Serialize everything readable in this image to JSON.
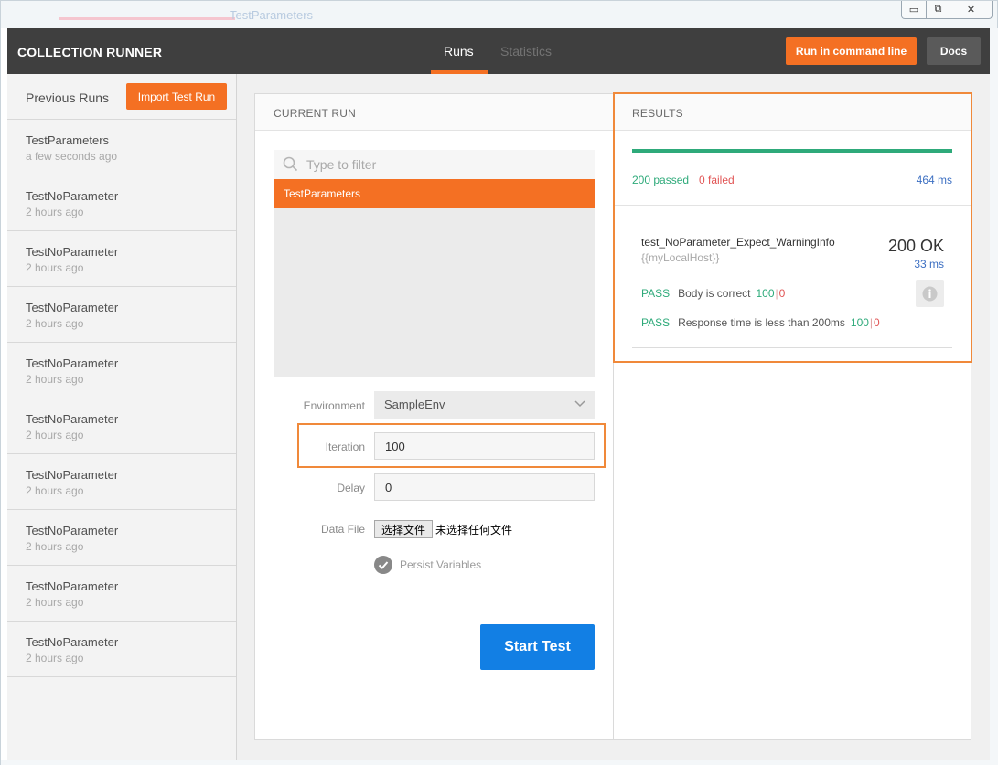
{
  "background": {
    "title": "TestParameters"
  },
  "window_controls": {
    "minimize": "▭",
    "maximize": "⧉",
    "close": "✕"
  },
  "header": {
    "title": "COLLECTION RUNNER",
    "tabs": [
      {
        "label": "Runs",
        "active": true
      },
      {
        "label": "Statistics",
        "active": false
      }
    ],
    "run_cmd_label": "Run in command line",
    "docs_label": "Docs",
    "accent_color": "#f47023"
  },
  "sidebar": {
    "heading": "Previous Runs",
    "import_label": "Import Test Run",
    "runs": [
      {
        "name": "TestParameters",
        "time": "a few seconds ago"
      },
      {
        "name": "TestNoParameter",
        "time": "2 hours ago"
      },
      {
        "name": "TestNoParameter",
        "time": "2 hours ago"
      },
      {
        "name": "TestNoParameter",
        "time": "2 hours ago"
      },
      {
        "name": "TestNoParameter",
        "time": "2 hours ago"
      },
      {
        "name": "TestNoParameter",
        "time": "2 hours ago"
      },
      {
        "name": "TestNoParameter",
        "time": "2 hours ago"
      },
      {
        "name": "TestNoParameter",
        "time": "2 hours ago"
      },
      {
        "name": "TestNoParameter",
        "time": "2 hours ago"
      },
      {
        "name": "TestNoParameter",
        "time": "2 hours ago"
      }
    ]
  },
  "current_run": {
    "title": "CURRENT RUN",
    "filter_placeholder": "Type to filter",
    "selected_collection": "TestParameters",
    "environment_label": "Environment",
    "environment_value": "SampleEnv",
    "iteration_label": "Iteration",
    "iteration_value": "100",
    "delay_label": "Delay",
    "delay_value": "0",
    "data_file_label": "Data File",
    "file_button_label": "选择文件",
    "file_status": "未选择任何文件",
    "persist_label": "Persist Variables",
    "persist_checked": true,
    "start_label": "Start Test",
    "start_color": "#127fe4"
  },
  "results": {
    "title": "RESULTS",
    "progress_fraction": 1.0,
    "passed_label": "200 passed",
    "failed_label": "0 failed",
    "total_time": "464 ms",
    "request": {
      "name": "test_NoParameter_Expect_WarningInfo",
      "url": "{{myLocalHost}}",
      "status": "200 OK",
      "time": "33 ms"
    },
    "tests": [
      {
        "result": "PASS",
        "name": "Body is correct",
        "pass_count": "100",
        "fail_count": "0"
      },
      {
        "result": "PASS",
        "name": "Response time is less than 200ms",
        "pass_count": "100",
        "fail_count": "0"
      }
    ]
  }
}
